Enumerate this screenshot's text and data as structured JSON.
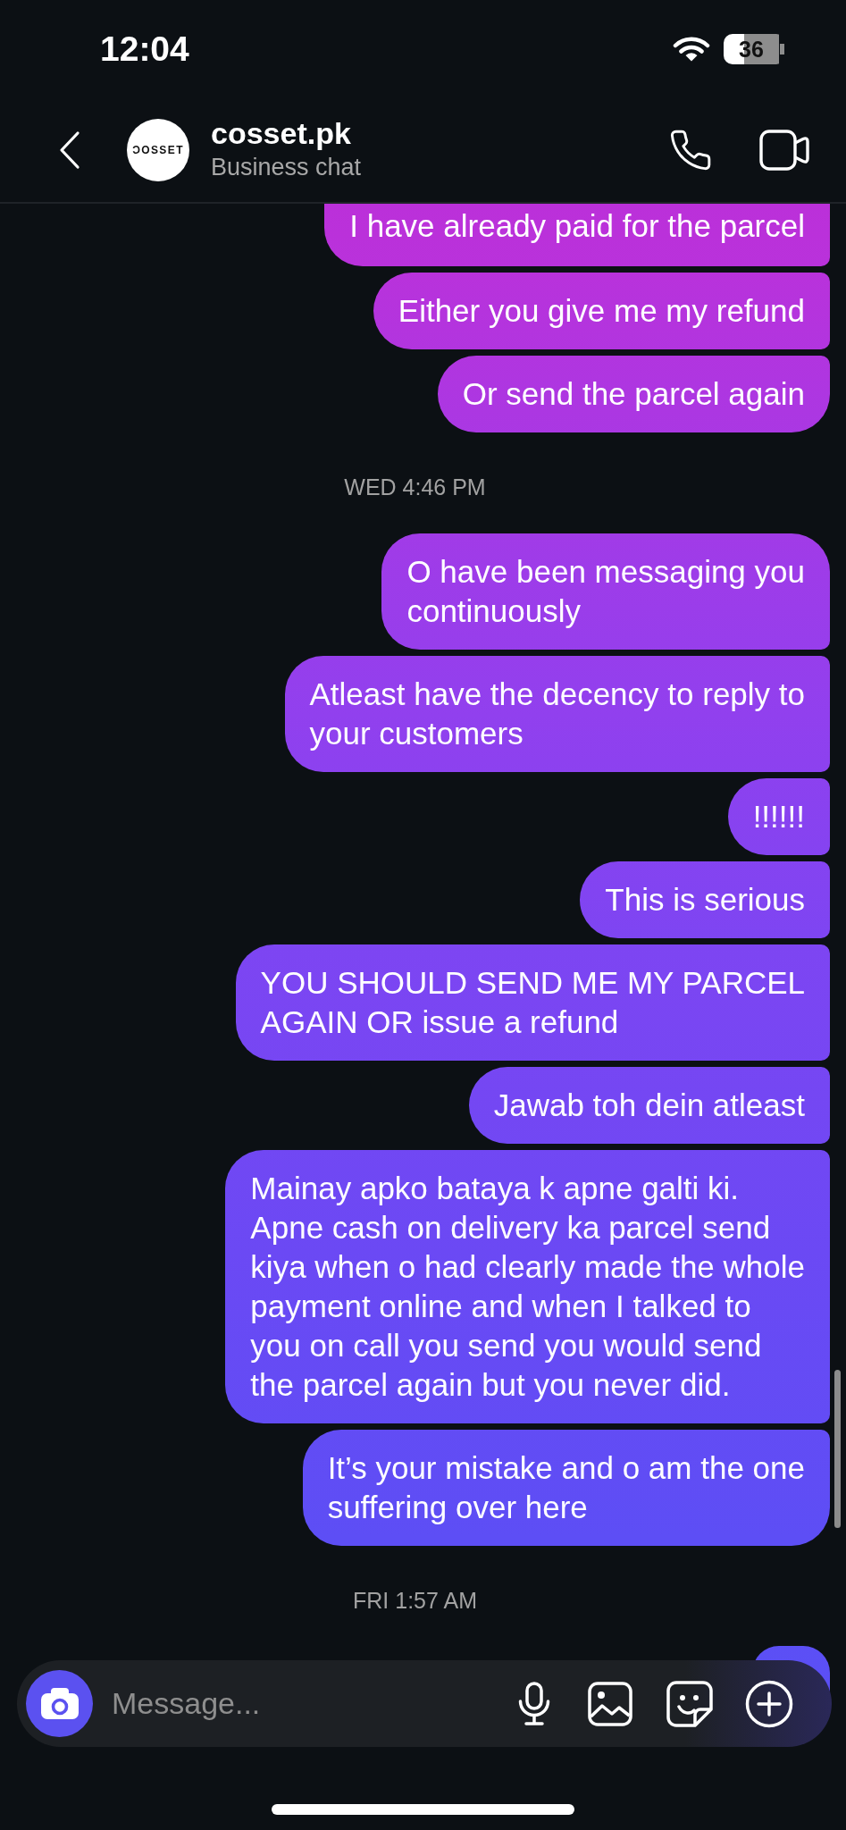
{
  "status_bar": {
    "time": "12:04",
    "battery": "36"
  },
  "header": {
    "avatar_text": "ƆOSSET",
    "name": "cosset.pk",
    "subtitle": "Business chat"
  },
  "chat": [
    {
      "kind": "message",
      "lines": [
        "I have already paid for the parcel"
      ]
    },
    {
      "kind": "message",
      "lines": [
        "Either you give me my refund"
      ]
    },
    {
      "kind": "message",
      "lines": [
        "Or send the parcel again"
      ]
    },
    {
      "kind": "timestamp",
      "text": "WED 4:46 PM"
    },
    {
      "kind": "message",
      "lines": [
        "O have been messaging you",
        "continuously"
      ]
    },
    {
      "kind": "message",
      "lines": [
        "Atleast have the decency to reply to",
        "your customers"
      ]
    },
    {
      "kind": "message",
      "lines": [
        "!!!!!!"
      ]
    },
    {
      "kind": "message",
      "lines": [
        "This is serious"
      ]
    },
    {
      "kind": "message",
      "lines": [
        "YOU SHOULD SEND ME MY PARCEL",
        "AGAIN OR issue a refund"
      ]
    },
    {
      "kind": "message",
      "lines": [
        "Jawab toh dein atleast"
      ]
    },
    {
      "kind": "message",
      "lines": [
        "Mainay apko bataya k apne galti ki.",
        "Apne cash on delivery ka parcel send",
        "kiya when o had clearly made the whole",
        "payment online and when I talked to",
        "you on call you send you would send",
        "the parcel again but you never did."
      ]
    },
    {
      "kind": "message",
      "lines": [
        "It’s your mistake and o am the one",
        "suffering over here"
      ]
    },
    {
      "kind": "timestamp",
      "text": "FRI 1:57 AM"
    }
  ],
  "composer": {
    "placeholder": "Message..."
  }
}
